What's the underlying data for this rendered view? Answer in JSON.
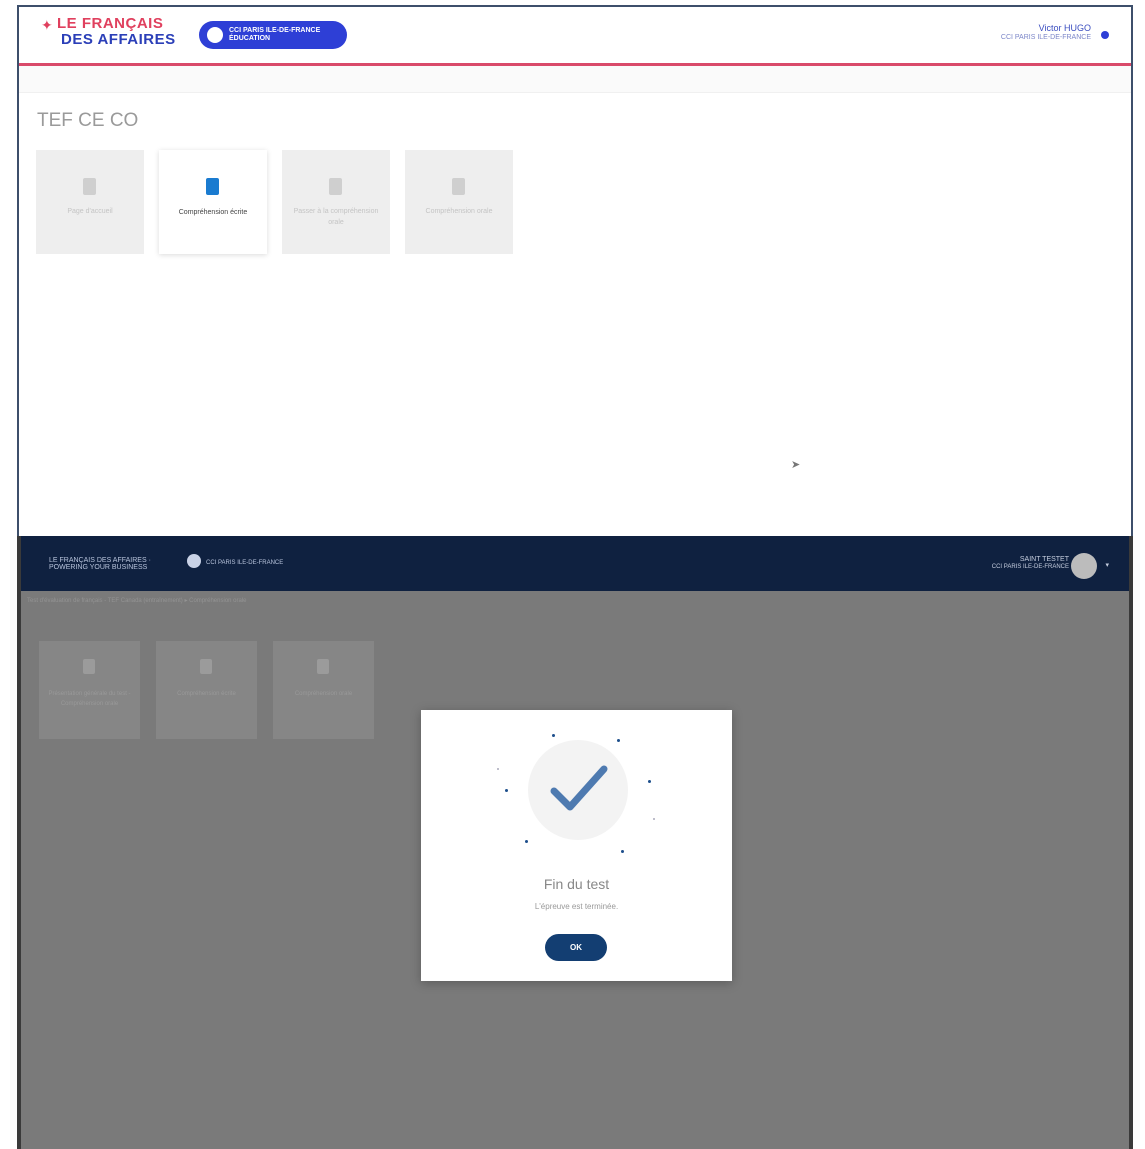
{
  "top_screen": {
    "logo": {
      "line1": "LE FRANÇAIS",
      "line2": "DES AFFAIRES"
    },
    "cci_badge": "CCI PARIS ILE-DE-FRANCE ÉDUCATION",
    "user": {
      "name": "Victor HUGO",
      "org": "CCI PARIS ILE-DE-FRANCE"
    },
    "page_title": "TEF CE CO",
    "tiles": [
      {
        "label": "Page d'accueil"
      },
      {
        "label": "Compréhension écrite"
      },
      {
        "label": "Passer à la compréhension orale"
      },
      {
        "label": "Compréhension orale"
      }
    ]
  },
  "bottom_screen": {
    "logo": "LE FRANÇAIS DES AFFAIRES · POWERING YOUR BUSINESS",
    "cci": "CCI PARIS ILE-DE-FRANCE",
    "user": {
      "name": "SAINT TESTET",
      "org": "CCI PARIS ILE-DE-FRANCE"
    },
    "breadcrumb": "Test d'évaluation de français - TEF Canada (entraînement) ▸ Compréhension orale",
    "tiles": [
      {
        "label": "Présentation générale du test - Compréhension orale"
      },
      {
        "label": "Compréhension écrite"
      },
      {
        "label": "Compréhension orale"
      }
    ],
    "modal": {
      "title": "Fin du test",
      "subtitle": "L'épreuve est terminée.",
      "ok": "OK"
    }
  },
  "colors": {
    "brand_red": "#e0405e",
    "brand_blue": "#2e3fd6",
    "header_navy": "#0f2140",
    "check_blue": "#4e7ab0",
    "ok_navy": "#133e72"
  },
  "icons": [
    "star-icon",
    "cci-logo-icon",
    "user-dot-icon",
    "document-icon",
    "checkmark-icon",
    "avatar-icon",
    "chevron-down-icon",
    "cursor-icon"
  ]
}
